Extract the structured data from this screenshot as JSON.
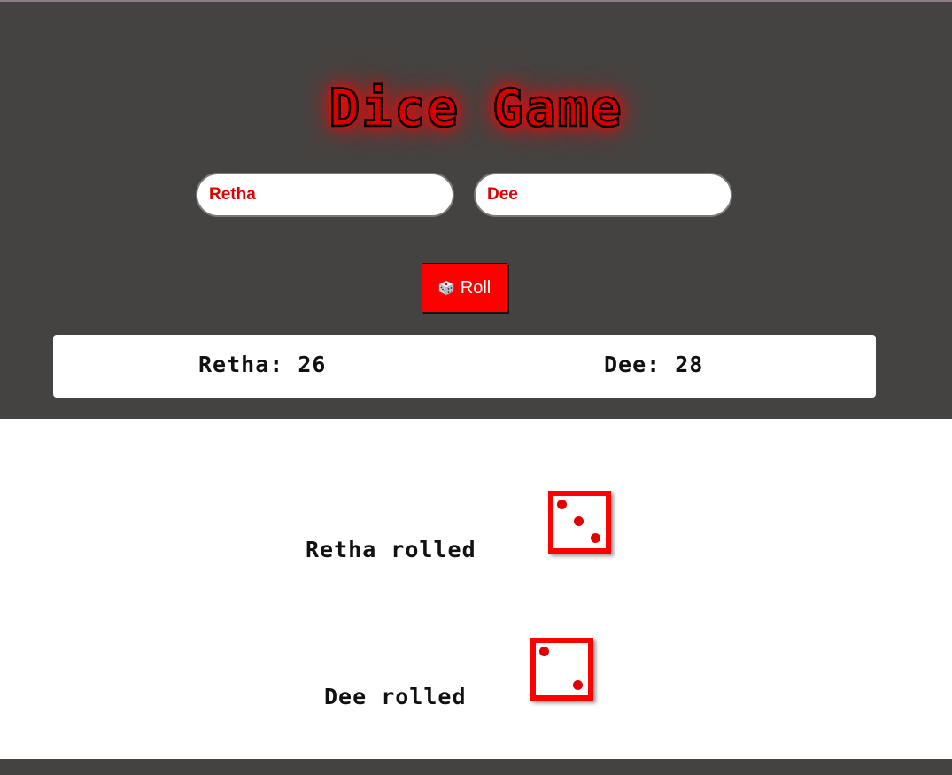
{
  "app": {
    "title": "Dice Game",
    "accent_color": "#ff0000",
    "header_background": "#454341"
  },
  "players": {
    "player1_name_value": "Retha",
    "player2_name_value": "Dee"
  },
  "controls": {
    "roll_label": "Roll",
    "roll_icon": "game-die-icon"
  },
  "scoreboard": {
    "player1_score_text": "Retha: 26",
    "player2_score_text": "Dee: 28"
  },
  "results": {
    "player1_rolled_text": "Retha rolled",
    "player1_die_value": 3,
    "player2_rolled_text": "Dee rolled",
    "player2_die_value": 2
  }
}
